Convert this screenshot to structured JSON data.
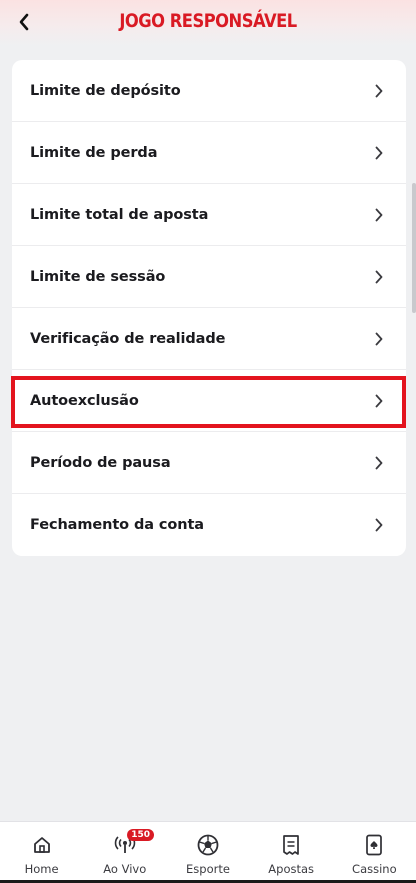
{
  "header": {
    "title": "JOGO RESPONSÁVEL",
    "back_icon": "chevron-left-icon"
  },
  "menu": {
    "items": [
      {
        "label": "Limite de depósito"
      },
      {
        "label": "Limite de perda"
      },
      {
        "label": "Limite total de aposta"
      },
      {
        "label": "Limite de sessão"
      },
      {
        "label": "Verificação de realidade"
      },
      {
        "label": "Autoexclusão",
        "highlighted": true
      },
      {
        "label": "Período de pausa"
      },
      {
        "label": "Fechamento da conta"
      }
    ]
  },
  "bottom_nav": {
    "items": [
      {
        "label": "Home",
        "icon": "home-icon"
      },
      {
        "label": "Ao Vivo",
        "icon": "live-broadcast-icon",
        "badge": "150"
      },
      {
        "label": "Esporte",
        "icon": "soccer-ball-icon"
      },
      {
        "label": "Apostas",
        "icon": "bet-slip-icon"
      },
      {
        "label": "Cassino",
        "icon": "playing-card-icon"
      }
    ]
  },
  "colors": {
    "accent": "#d91a24",
    "highlight_border": "#e3141e",
    "background": "#eff0f2",
    "card": "#ffffff",
    "text": "#1b1b1f"
  }
}
